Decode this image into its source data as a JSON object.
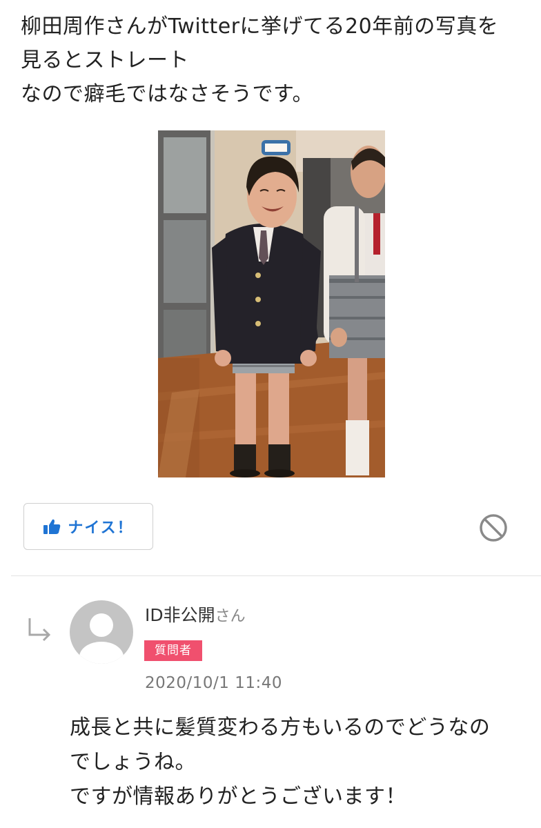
{
  "answer": {
    "lines": [
      "柳田周作さんがTwitterに挙げてる20年前の写真を",
      "見るとストレート",
      "なので癖毛ではなさそうです。"
    ]
  },
  "photo": {
    "icon": "childhood-photo"
  },
  "actions": {
    "nice_label": "ナイス！",
    "nice_icon": "thumbs-up-icon",
    "report_icon": "prohibited-icon",
    "accent_color": "#1f74d4"
  },
  "reply": {
    "username": "ID非公開",
    "username_suffix": "さん",
    "badge": "質問者",
    "badge_color": "#f0506e",
    "timestamp": "2020/10/1 11:40",
    "lines": [
      "成長と共に髪質変わる方もいるのでどうなの",
      "でしょうね。",
      "ですが情報ありがとうございます！"
    ]
  }
}
